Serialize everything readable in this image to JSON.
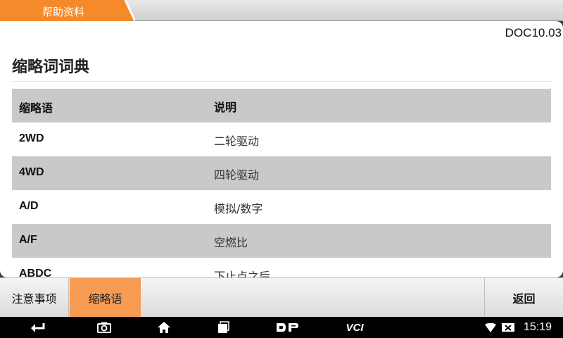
{
  "top_tabs": {
    "active_label": "帮助资料"
  },
  "content": {
    "doc_code": "DOC10.03",
    "title": "缩略词词典",
    "table": {
      "headers": [
        "缩略语",
        "说明"
      ],
      "rows": [
        [
          "2WD",
          "二轮驱动"
        ],
        [
          "4WD",
          "四轮驱动"
        ],
        [
          "A/D",
          "模拟/数字"
        ],
        [
          "A/F",
          "空燃比"
        ],
        [
          "ABDC",
          "下止点之后"
        ]
      ]
    }
  },
  "toolbar": {
    "notes_label": "注意事项",
    "abbr_label": "缩略语",
    "back_label": "返回"
  },
  "system_bar": {
    "icons": [
      "back-icon",
      "camera-icon",
      "home-icon",
      "recent-apps-icon",
      "dp-icon",
      "vci-icon",
      "wifi-icon",
      "no-sim-icon"
    ],
    "vci_text": "VCI",
    "time": "15:19"
  },
  "colors": {
    "accent": "#f89b52",
    "tab_active": "#f58a2a",
    "row_shade": "#c9c9c9"
  }
}
